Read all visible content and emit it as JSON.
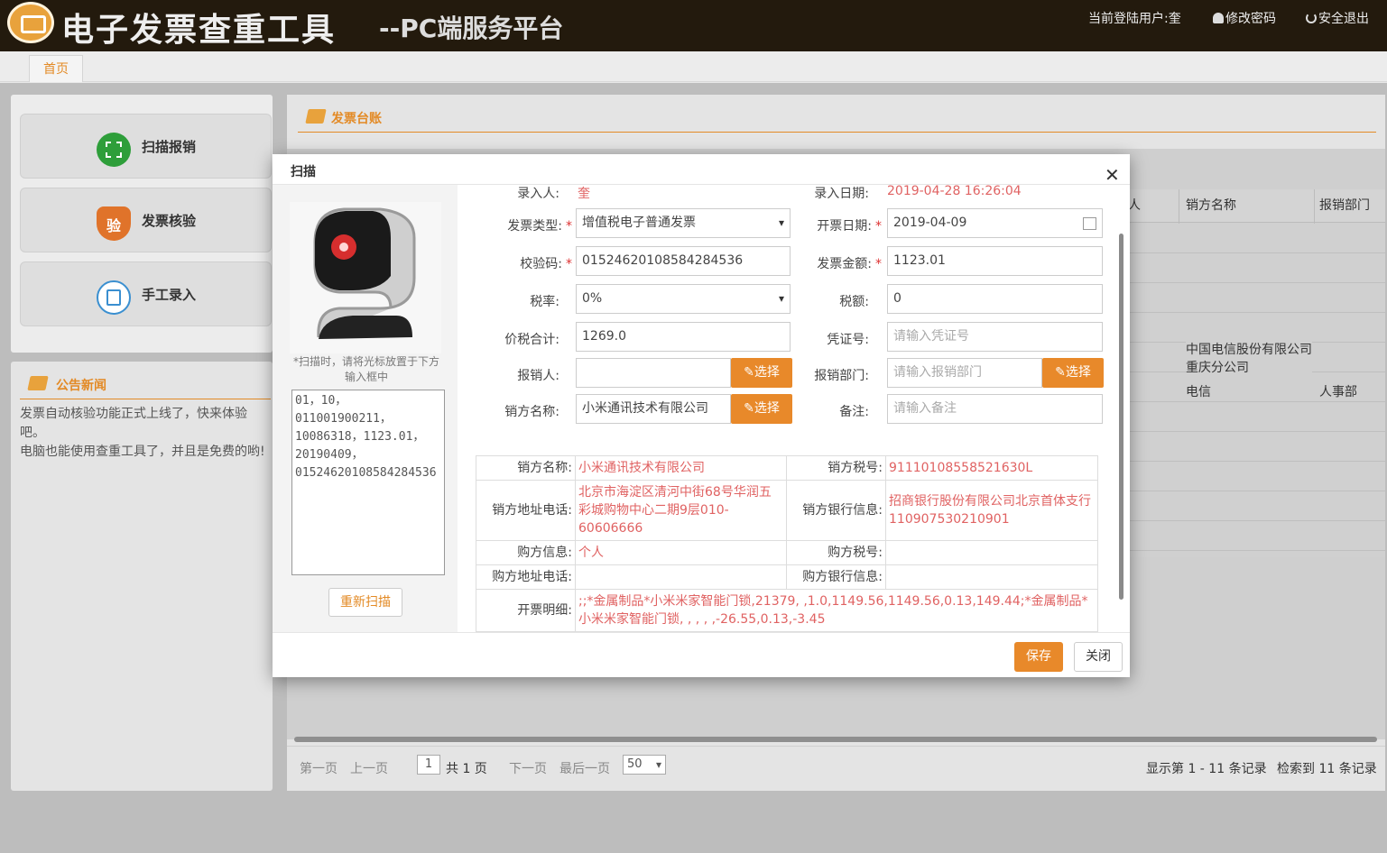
{
  "header": {
    "title": "电子发票查重工具",
    "subtitle": "--PC端服务平台",
    "user_label": "当前登陆用户:奎",
    "change_password": "修改密码",
    "logout": "安全退出"
  },
  "tabs": {
    "home": "首页"
  },
  "left_menu": [
    {
      "label": "扫描报销",
      "icon": "scan-icon"
    },
    {
      "label": "发票核验",
      "icon": "shield-verify-icon",
      "badge": "验"
    },
    {
      "label": "手工录入",
      "icon": "document-edit-icon"
    }
  ],
  "news": {
    "title": "公告新闻",
    "lines": [
      "发票自动核验功能正式上线了，快来体验吧。",
      "电脑也能使用查重工具了，并且是免费的哟!"
    ]
  },
  "ledger": {
    "title": "发票台账",
    "columns": [
      "人",
      "销方名称",
      "报销部门"
    ],
    "visible_cells": [
      {
        "seller": "中国电信股份有限公司重庆分公司",
        "dept": ""
      },
      {
        "seller": "电信",
        "dept": "人事部"
      }
    ],
    "pager": {
      "first": "第一页",
      "prev": "上一页",
      "page": "1",
      "total": "共 1 页",
      "next": "下一页",
      "last": "最后一页",
      "page_size": "50",
      "showing": "显示第 1 - 11 条记录",
      "found": "检索到 11 条记录"
    }
  },
  "modal": {
    "title": "扫描",
    "close_glyph": "✕",
    "scan_hint": "*扫描时，请将光标放置于下方输入框中",
    "scan_text": "01，10，\n011001900211，\n10086318，1123.01，\n20190409，\n01524620108584284536",
    "rescan": "重新扫描",
    "form": {
      "entered_by_label": "录入人:",
      "entered_by": "奎",
      "entry_date_label": "录入日期:",
      "entry_date": "2019-04-28 16:26:04",
      "invoice_type_label": "发票类型:",
      "invoice_type": "增值税电子普通发票",
      "issue_date_label": "开票日期:",
      "issue_date": "2019-04-09",
      "check_code_label": "校验码:",
      "check_code": "01524620108584284536",
      "amount_label": "发票金额:",
      "amount": "1123.01",
      "tax_rate_label": "税率:",
      "tax_rate": "0%",
      "tax_amount_label": "税额:",
      "tax_amount": "0",
      "total_label": "价税合计:",
      "total": "1269.0",
      "voucher_label": "凭证号:",
      "voucher_placeholder": "请输入凭证号",
      "claimant_label": "报销人:",
      "claimant": "",
      "dept_label": "报销部门:",
      "dept_placeholder": "请输入报销部门",
      "seller_label": "销方名称:",
      "seller": "小米通讯技术有限公司",
      "remark_label": "备注:",
      "remark_placeholder": "请输入备注",
      "select": "选择"
    },
    "info": {
      "seller_name_k": "销方名称:",
      "seller_name_v": "小米通讯技术有限公司",
      "seller_tax_k": "销方税号:",
      "seller_tax_v": "91110108558521630L",
      "seller_addr_k": "销方地址电话:",
      "seller_addr_v": "北京市海淀区清河中街68号华润五彩城购物中心二期9层010-60606666",
      "seller_bank_k": "销方银行信息:",
      "seller_bank_v": "招商银行股份有限公司北京首体支行110907530210901",
      "buyer_info_k": "购方信息:",
      "buyer_info_v": "个人",
      "buyer_tax_k": "购方税号:",
      "buyer_tax_v": "",
      "buyer_addr_k": "购方地址电话:",
      "buyer_addr_v": "",
      "buyer_bank_k": "购方银行信息:",
      "buyer_bank_v": "",
      "detail_k": "开票明细:",
      "detail_v": ";;*金属制品*小米米家智能门锁,21379, ,1.0,1149.56,1149.56,0.13,149.44;*金属制品*小米米家智能门锁, , , , ,-26.55,0.13,-3.45"
    },
    "save": "保存",
    "close": "关闭"
  }
}
